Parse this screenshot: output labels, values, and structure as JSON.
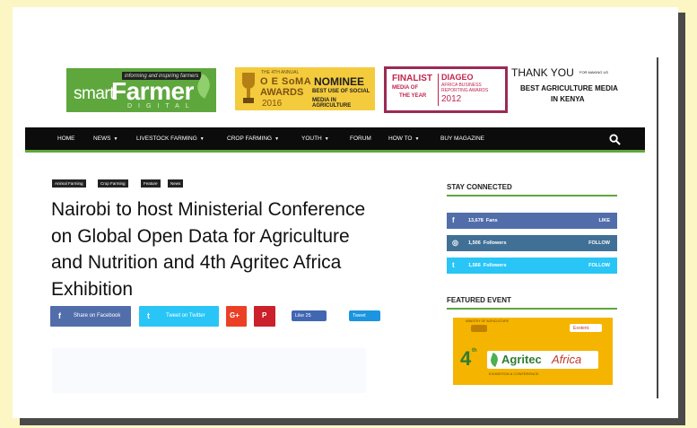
{
  "header": {
    "logo": {
      "tagline": "informing and inspiring farmers",
      "smart": "smart",
      "farmer": "Farmer",
      "digital": "DIGITAL"
    },
    "soma": {
      "annual": "THE 4TH ANNUAL",
      "brand": "O E SoMA",
      "awards": "AWARDS",
      "year": "2016",
      "nominee": "NOMINEE",
      "category_line1": "BEST USE OF SOCIAL",
      "category_line2": "MEDIA IN AGRICULTURE"
    },
    "finalist": {
      "word": "FINALIST",
      "line2": "MEDIA OF",
      "line3": "THE YEAR",
      "brand": "DIAGEO",
      "sub1": "AFRICA BUSINESS",
      "sub2": "REPORTING AWARDS",
      "year": "2012"
    },
    "thanks": {
      "line1": "THANK YOU",
      "line1_small": "FOR MAKING US",
      "line2": "BEST AGRICULTURE MEDIA",
      "line3": "IN KENYA"
    }
  },
  "nav": {
    "items": [
      "HOME",
      "NEWS",
      "LIVESTOCK FARMING",
      "CROP FARMING",
      "YOUTH",
      "FORUM",
      "HOW TO",
      "BUY MAGAZINE"
    ],
    "search_icon": "search-icon"
  },
  "article": {
    "tags": [
      "Animal Farming",
      "Crop Farming",
      "Feature",
      "News"
    ],
    "title_lines": [
      "Nairobi to host Ministerial Conference",
      "on Global Open Data for Agriculture",
      "and Nutrition and 4th Agritec Africa",
      "Exhibition"
    ],
    "share": {
      "facebook": "Share on Facebook",
      "twitter": "Tweet on Twitter",
      "googleplus": "G+",
      "pinterest": "P"
    },
    "like_label": "Like 25",
    "tweet_label": "Tweet"
  },
  "sidebar": {
    "stay_connected": "STAY CONNECTED",
    "rows": [
      {
        "icon": "f",
        "count": "13,678",
        "label": "Fans",
        "action": "LIKE"
      },
      {
        "icon": "◎",
        "count": "1,506",
        "label": "Followers",
        "action": "FOLLOW"
      },
      {
        "icon": "t",
        "count": "1,566",
        "label": "Followers",
        "action": "FOLLOW"
      }
    ],
    "featured_event": "FEATURED EVENT",
    "event": {
      "ministry": "MINISTRY OF AGRICULTURE",
      "expo": "Exoteric",
      "num": "4",
      "th": "th",
      "agritec": "Agritec",
      "africa": "Africa",
      "sub": "EXHIBITION & CONFERENCE"
    }
  },
  "colors": {
    "green": "#5ea73d",
    "facebook": "#516eab",
    "instagram": "#417096",
    "twitter": "#29c5f6",
    "googleplus": "#eb4026",
    "pinterest": "#ca212a"
  }
}
